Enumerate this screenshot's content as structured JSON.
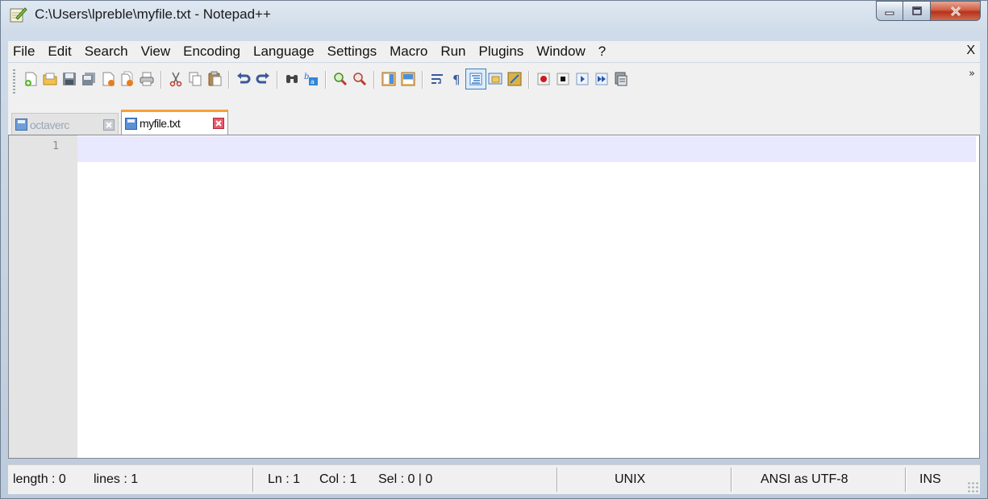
{
  "window": {
    "title": "C:\\Users\\lpreble\\myfile.txt - Notepad++",
    "controls": [
      "minimize-icon",
      "maximize-icon",
      "close-icon"
    ]
  },
  "menu": {
    "items": [
      "File",
      "Edit",
      "Search",
      "View",
      "Encoding",
      "Language",
      "Settings",
      "Macro",
      "Run",
      "Plugins",
      "Window",
      "?"
    ],
    "close_label": "X"
  },
  "toolbar": {
    "icons": [
      "new-file-icon",
      "open-file-icon",
      "save-icon",
      "save-all-icon",
      "close-file-icon",
      "close-all-icon",
      "print-icon",
      "cut-icon",
      "copy-icon",
      "paste-icon",
      "undo-icon",
      "redo-icon",
      "find-icon",
      "replace-icon",
      "zoom-in-icon",
      "zoom-out-icon",
      "sync-vertical-icon",
      "sync-horizontal-icon",
      "word-wrap-icon",
      "show-all-chars-icon",
      "indent-guide-icon",
      "user-defined-language-icon",
      "function-list-icon",
      "record-macro-icon",
      "stop-recording-icon",
      "playback-macro-icon",
      "run-macro-multiple-icon",
      "save-macro-icon"
    ],
    "overflow_label": "»"
  },
  "tabs": [
    {
      "label": "octaverc",
      "active": false
    },
    {
      "label": "myfile.txt",
      "active": true
    }
  ],
  "editor": {
    "line_numbers": [
      "1"
    ],
    "content": ""
  },
  "status": {
    "length": "length : 0",
    "lines": "lines : 1",
    "ln": "Ln : 1",
    "col": "Col : 1",
    "sel": "Sel : 0 | 0",
    "eol": "UNIX",
    "encoding": "ANSI as UTF-8",
    "mode": "INS"
  },
  "colors": {
    "active_tab_accent": "#f6a13a",
    "current_line_highlight": "#e8e8ff",
    "gutter": "#e4e4e4",
    "close_button": "#c9472c"
  }
}
